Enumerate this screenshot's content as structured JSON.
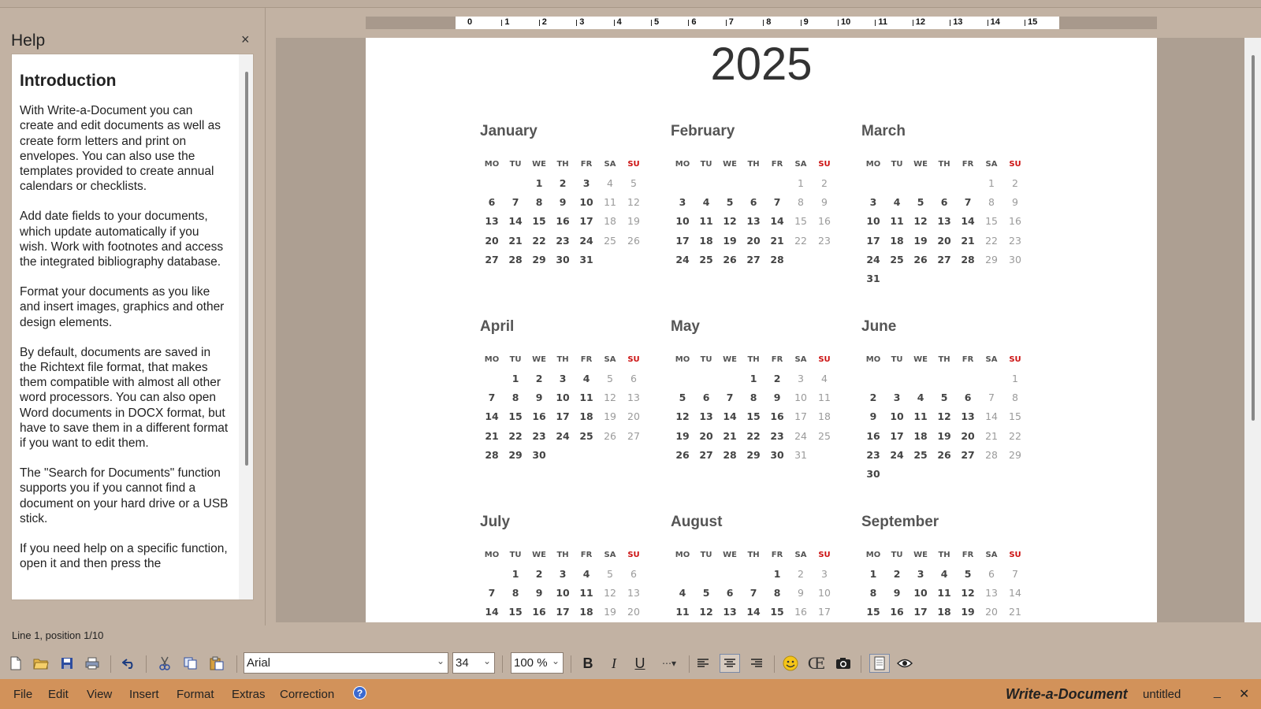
{
  "help": {
    "title": "Help",
    "close": "×",
    "heading": "Introduction",
    "paragraphs": [
      "With Write-a-Document you can create and edit documents as well as create form letters and print on envelopes. You can also use the templates provided to create annual calendars or checklists.",
      "Add date fields to your documents, which update automatically if you wish. Work with footnotes and access the integrated bibliography database.",
      "Format your documents as you like and insert images, graphics and other design elements.",
      "By default, documents are saved in the Richtext file format, that makes them compatible with almost all other word processors. You can also open Word documents in DOCX format, but have to save them in a different format if you want to edit them.",
      "The \"Search for Documents\" function supports you if you cannot find a document on your hard drive or a USB stick.",
      "If you need help on a specific function, open it and then press the"
    ]
  },
  "ruler": {
    "numbers": [
      "0",
      "1",
      "2",
      "3",
      "4",
      "5",
      "6",
      "7",
      "8",
      "9",
      "10",
      "11",
      "12",
      "13",
      "14",
      "15"
    ]
  },
  "document": {
    "year": "2025",
    "weekdays": [
      "MO",
      "TU",
      "WE",
      "TH",
      "FR",
      "SA",
      "SU"
    ],
    "months": [
      {
        "name": "January",
        "rows": [
          [
            "",
            "",
            "1",
            "2",
            "3",
            "4",
            "5"
          ],
          [
            "6",
            "7",
            "8",
            "9",
            "10",
            "11",
            "12"
          ],
          [
            "13",
            "14",
            "15",
            "16",
            "17",
            "18",
            "19"
          ],
          [
            "20",
            "21",
            "22",
            "23",
            "24",
            "25",
            "26"
          ],
          [
            "27",
            "28",
            "29",
            "30",
            "31",
            "",
            ""
          ]
        ]
      },
      {
        "name": "February",
        "rows": [
          [
            "",
            "",
            "",
            "",
            "",
            "1",
            "2"
          ],
          [
            "3",
            "4",
            "5",
            "6",
            "7",
            "8",
            "9"
          ],
          [
            "10",
            "11",
            "12",
            "13",
            "14",
            "15",
            "16"
          ],
          [
            "17",
            "18",
            "19",
            "20",
            "21",
            "22",
            "23"
          ],
          [
            "24",
            "25",
            "26",
            "27",
            "28",
            "",
            ""
          ]
        ]
      },
      {
        "name": "March",
        "rows": [
          [
            "",
            "",
            "",
            "",
            "",
            "1",
            "2"
          ],
          [
            "3",
            "4",
            "5",
            "6",
            "7",
            "8",
            "9"
          ],
          [
            "10",
            "11",
            "12",
            "13",
            "14",
            "15",
            "16"
          ],
          [
            "17",
            "18",
            "19",
            "20",
            "21",
            "22",
            "23"
          ],
          [
            "24",
            "25",
            "26",
            "27",
            "28",
            "29",
            "30"
          ],
          [
            "31",
            "",
            "",
            "",
            "",
            "",
            ""
          ]
        ]
      },
      {
        "name": "April",
        "rows": [
          [
            "",
            "1",
            "2",
            "3",
            "4",
            "5",
            "6"
          ],
          [
            "7",
            "8",
            "9",
            "10",
            "11",
            "12",
            "13"
          ],
          [
            "14",
            "15",
            "16",
            "17",
            "18",
            "19",
            "20"
          ],
          [
            "21",
            "22",
            "23",
            "24",
            "25",
            "26",
            "27"
          ],
          [
            "28",
            "29",
            "30",
            "",
            "",
            "",
            ""
          ]
        ]
      },
      {
        "name": "May",
        "rows": [
          [
            "",
            "",
            "",
            "1",
            "2",
            "3",
            "4"
          ],
          [
            "5",
            "6",
            "7",
            "8",
            "9",
            "10",
            "11"
          ],
          [
            "12",
            "13",
            "14",
            "15",
            "16",
            "17",
            "18"
          ],
          [
            "19",
            "20",
            "21",
            "22",
            "23",
            "24",
            "25"
          ],
          [
            "26",
            "27",
            "28",
            "29",
            "30",
            "31",
            ""
          ]
        ]
      },
      {
        "name": "June",
        "rows": [
          [
            "",
            "",
            "",
            "",
            "",
            "",
            "1"
          ],
          [
            "2",
            "3",
            "4",
            "5",
            "6",
            "7",
            "8"
          ],
          [
            "9",
            "10",
            "11",
            "12",
            "13",
            "14",
            "15"
          ],
          [
            "16",
            "17",
            "18",
            "19",
            "20",
            "21",
            "22"
          ],
          [
            "23",
            "24",
            "25",
            "26",
            "27",
            "28",
            "29"
          ],
          [
            "30",
            "",
            "",
            "",
            "",
            "",
            ""
          ]
        ]
      },
      {
        "name": "July",
        "rows": [
          [
            "",
            "1",
            "2",
            "3",
            "4",
            "5",
            "6"
          ],
          [
            "7",
            "8",
            "9",
            "10",
            "11",
            "12",
            "13"
          ],
          [
            "14",
            "15",
            "16",
            "17",
            "18",
            "19",
            "20"
          ]
        ]
      },
      {
        "name": "August",
        "rows": [
          [
            "",
            "",
            "",
            "",
            "1",
            "2",
            "3"
          ],
          [
            "4",
            "5",
            "6",
            "7",
            "8",
            "9",
            "10"
          ],
          [
            "11",
            "12",
            "13",
            "14",
            "15",
            "16",
            "17"
          ]
        ]
      },
      {
        "name": "September",
        "rows": [
          [
            "1",
            "2",
            "3",
            "4",
            "5",
            "6",
            "7"
          ],
          [
            "8",
            "9",
            "10",
            "11",
            "12",
            "13",
            "14"
          ],
          [
            "15",
            "16",
            "17",
            "18",
            "19",
            "20",
            "21"
          ]
        ]
      }
    ]
  },
  "status": {
    "position": "Line 1, position 1/10"
  },
  "toolbar": {
    "font": "Arial",
    "size": "34",
    "zoom": "100 %"
  },
  "menu": {
    "items": [
      "File",
      "Edit",
      "View",
      "Insert",
      "Format",
      "Extras",
      "Correction"
    ],
    "help_glyph": "?",
    "app_name": "Write-a-Document",
    "doc_name": "untitled",
    "minimize": "_",
    "close": "✕"
  },
  "colors": {
    "menubar": "#d2925a",
    "window_bg": "#c2b2a3",
    "sunday_red": "#cc1111"
  }
}
